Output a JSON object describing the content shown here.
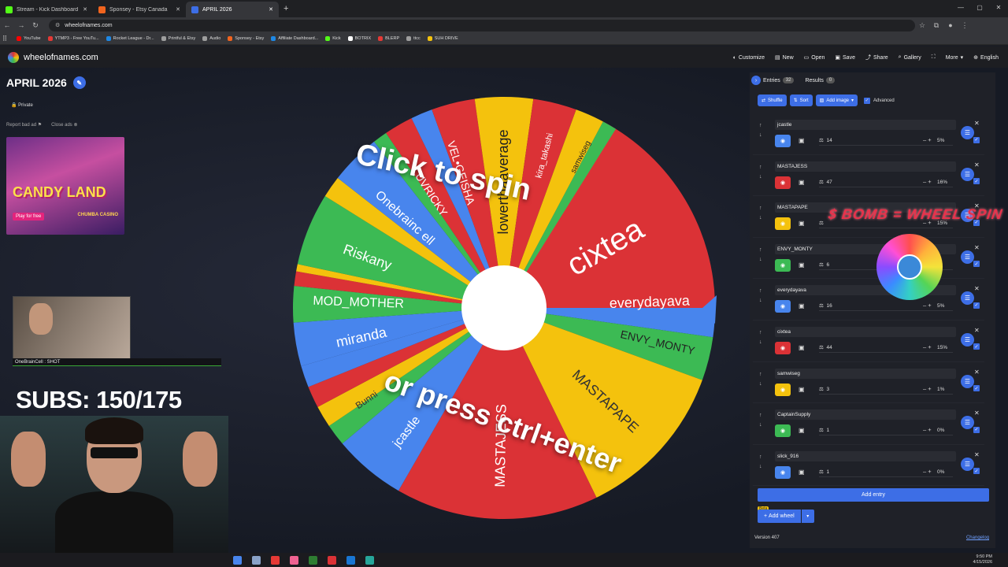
{
  "browser": {
    "tabs": [
      {
        "title": "Stream - Kick Dashboard",
        "color": "#53fc18"
      },
      {
        "title": "Sponsey - Etsy Canada",
        "color": "#f1641e"
      },
      {
        "title": "APRIL 2026",
        "color": "#3d6ee6"
      }
    ],
    "url": "wheelofnames.com",
    "bookmarks": [
      {
        "label": "YouTube",
        "color": "#ff0000"
      },
      {
        "label": "YTMP3 - Free YouTu...",
        "color": "#e53935"
      },
      {
        "label": "Rocket League - Dr...",
        "color": "#1e88e5"
      },
      {
        "label": "Printful & Etsy",
        "color": "#9e9e9e"
      },
      {
        "label": "Audio",
        "color": "#9e9e9e"
      },
      {
        "label": "Sponsey - Etsy",
        "color": "#f1641e"
      },
      {
        "label": "Affiliate Dashboard...",
        "color": "#1e88e5"
      },
      {
        "label": "Kick",
        "color": "#53fc18"
      },
      {
        "label": "BOTRIX",
        "color": "#ffffff"
      },
      {
        "label": "BLERP",
        "color": "#e53935"
      },
      {
        "label": "ttcc",
        "color": "#9e9e9e"
      },
      {
        "label": "SUH DRIVE",
        "color": "#f4c20d"
      }
    ]
  },
  "site": {
    "name": "wheelofnames.com",
    "menu": [
      "Customize",
      "New",
      "Open",
      "Save",
      "Share",
      "Gallery",
      "Fullscreen",
      "More",
      "English"
    ]
  },
  "left": {
    "wheel_title": "APRIL 2026",
    "privacy": "Private",
    "report_ad": "Report bad ad",
    "close_ads": "Close ads",
    "ad_title": "CANDY LAND",
    "ad_button": "Play for free",
    "ad_brand": "CHUMBA CASINO",
    "chat_line": "OneBrainCell : SHOT",
    "subs": "SUBS: 150/175"
  },
  "wheel": {
    "click_text": "Click to spin",
    "press_text": "or press ctrl+enter",
    "colors": [
      "#db3236",
      "#f4c20d",
      "#3cba54",
      "#4885ed"
    ],
    "labels": [
      {
        "text": "cixtea",
        "angle": -30,
        "r": 150,
        "size": 40,
        "color": "#fff"
      },
      {
        "text": "everydayava",
        "angle": -2,
        "r": 185,
        "size": 18,
        "color": "#fff"
      },
      {
        "text": "ENVY_MONTY",
        "angle": 13,
        "r": 200,
        "size": 14,
        "color": "#222"
      },
      {
        "text": "MASTAPAPE",
        "angle": 43,
        "r": 175,
        "size": 18,
        "color": "#333"
      },
      {
        "text": "MASTAJESS",
        "angle": 91,
        "r": 175,
        "size": 18,
        "color": "#fff"
      },
      {
        "text": "jcastle",
        "angle": 128,
        "r": 200,
        "size": 16,
        "color": "#fff"
      },
      {
        "text": "Bunni",
        "angle": 146,
        "r": 210,
        "size": 12,
        "color": "#333"
      },
      {
        "text": "miranda",
        "angle": 168,
        "r": 185,
        "size": 18,
        "color": "#fff"
      },
      {
        "text": "MOD_MOTHER",
        "angle": 182,
        "r": 185,
        "size": 16,
        "color": "#fff"
      },
      {
        "text": "Riskany",
        "angle": 200,
        "r": 185,
        "size": 18,
        "color": "#fff"
      },
      {
        "text": "Onebrainc ell",
        "angle": 222,
        "r": 170,
        "size": 16,
        "color": "#fff"
      },
      {
        "text": "LUVRICKY",
        "angle": 237,
        "r": 175,
        "size": 14,
        "color": "#fff"
      },
      {
        "text": "VEL•GEISHA",
        "angle": 252,
        "r": 180,
        "size": 14,
        "color": "#fff"
      },
      {
        "text": "lowerthaaverage",
        "angle": 270,
        "r": 160,
        "size": 18,
        "color": "#222"
      },
      {
        "text": "kira_takashi",
        "angle": 285,
        "r": 200,
        "size": 11,
        "color": "#fff"
      },
      {
        "text": "samwiseg",
        "angle": 297,
        "r": 215,
        "size": 10,
        "color": "#222"
      }
    ]
  },
  "panel": {
    "tab_entries": "Entries",
    "entries_count": "32",
    "tab_results": "Results",
    "results_count": "0",
    "shuffle": "Shuffle",
    "sort": "Sort",
    "add_image": "Add image",
    "advanced": "Advanced",
    "entries": [
      {
        "name": "jcastle",
        "weight": "14",
        "pct": "5%",
        "color": "#4885ed"
      },
      {
        "name": "MASTAJESS",
        "weight": "47",
        "pct": "16%",
        "color": "#db3236"
      },
      {
        "name": "MASTAPAPE",
        "weight": "",
        "pct": "15%",
        "color": "#f4c20d"
      },
      {
        "name": "ENVY_MONTY",
        "weight": "6",
        "pct": "%",
        "color": "#3cba54"
      },
      {
        "name": "everydayava",
        "weight": "16",
        "pct": "5%",
        "color": "#4885ed"
      },
      {
        "name": "cixtea",
        "weight": "44",
        "pct": "15%",
        "color": "#db3236"
      },
      {
        "name": "samwiseg",
        "weight": "3",
        "pct": "1%",
        "color": "#f4c20d"
      },
      {
        "name": "CaptainSupply",
        "weight": "1",
        "pct": "0%",
        "color": "#3cba54"
      },
      {
        "name": "slick_916",
        "weight": "1",
        "pct": "0%",
        "color": "#4885ed"
      }
    ],
    "add_entry": "Add entry",
    "beta": "Beta",
    "add_wheel": "Add wheel",
    "version": "Version 407",
    "changelog": "Changelog"
  },
  "overlay": {
    "bomb_text": "$ BOMB = WHEEL SPIN"
  },
  "taskbar": {
    "time": "9:50 PM",
    "date": "4/15/2026",
    "icons": [
      "#4885ed",
      "#8aa2c8",
      "#e53935",
      "#f06292",
      "#2e7d32",
      "#db3236",
      "#1976d2",
      "#26a69a"
    ]
  }
}
